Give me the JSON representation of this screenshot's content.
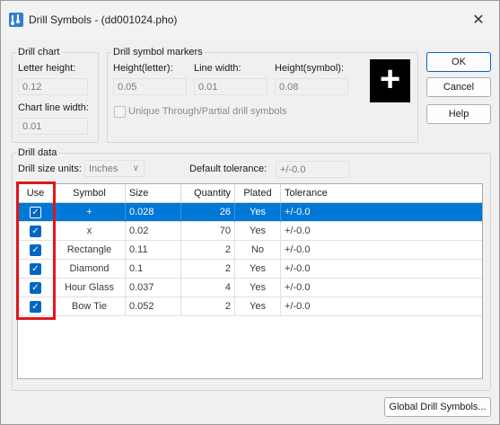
{
  "window": {
    "title": "Drill Symbols - (dd001024.pho)",
    "close_glyph": "✕"
  },
  "drill_chart": {
    "legend": "Drill chart",
    "letter_height_label": "Letter height:",
    "letter_height_value": "0.12",
    "chart_line_width_label": "Chart line width:",
    "chart_line_width_value": "0.01"
  },
  "markers": {
    "legend": "Drill symbol markers",
    "height_letter_label": "Height(letter):",
    "height_letter_value": "0.05",
    "line_width_label": "Line width:",
    "line_width_value": "0.01",
    "height_symbol_label": "Height(symbol):",
    "height_symbol_value": "0.08",
    "preview_symbol": "+",
    "unique_checkbox_label": "Unique Through/Partial drill symbols"
  },
  "buttons": {
    "ok": "OK",
    "cancel": "Cancel",
    "help": "Help",
    "global": "Global Drill Symbols..."
  },
  "drill_data": {
    "legend": "Drill data",
    "units_label": "Drill size units:",
    "units_value": "Inches",
    "tolerance_label": "Default tolerance:",
    "tolerance_value": "+/-0.0"
  },
  "table": {
    "headers": {
      "use": "Use",
      "symbol": "Symbol",
      "size": "Size",
      "quantity": "Quantity",
      "plated": "Plated",
      "tolerance": "Tolerance"
    },
    "rows": [
      {
        "use": "✓",
        "symbol": "+",
        "size": "0.028",
        "quantity": "26",
        "plated": "Yes",
        "tolerance": "+/-0.0"
      },
      {
        "use": "✓",
        "symbol": "x",
        "size": "0.02",
        "quantity": "70",
        "plated": "Yes",
        "tolerance": "+/-0.0"
      },
      {
        "use": "✓",
        "symbol": "Rectangle",
        "size": "0.11",
        "quantity": "2",
        "plated": "No",
        "tolerance": "+/-0.0"
      },
      {
        "use": "✓",
        "symbol": "Diamond",
        "size": "0.1",
        "quantity": "2",
        "plated": "Yes",
        "tolerance": "+/-0.0"
      },
      {
        "use": "✓",
        "symbol": "Hour Glass",
        "size": "0.037",
        "quantity": "4",
        "plated": "Yes",
        "tolerance": "+/-0.0"
      },
      {
        "use": "✓",
        "symbol": "Bow Tie",
        "size": "0.052",
        "quantity": "2",
        "plated": "Yes",
        "tolerance": "+/-0.0"
      }
    ]
  },
  "colors": {
    "selection": "#0078d7",
    "highlight_box": "#e0151b",
    "checkbox": "#0067c0"
  }
}
